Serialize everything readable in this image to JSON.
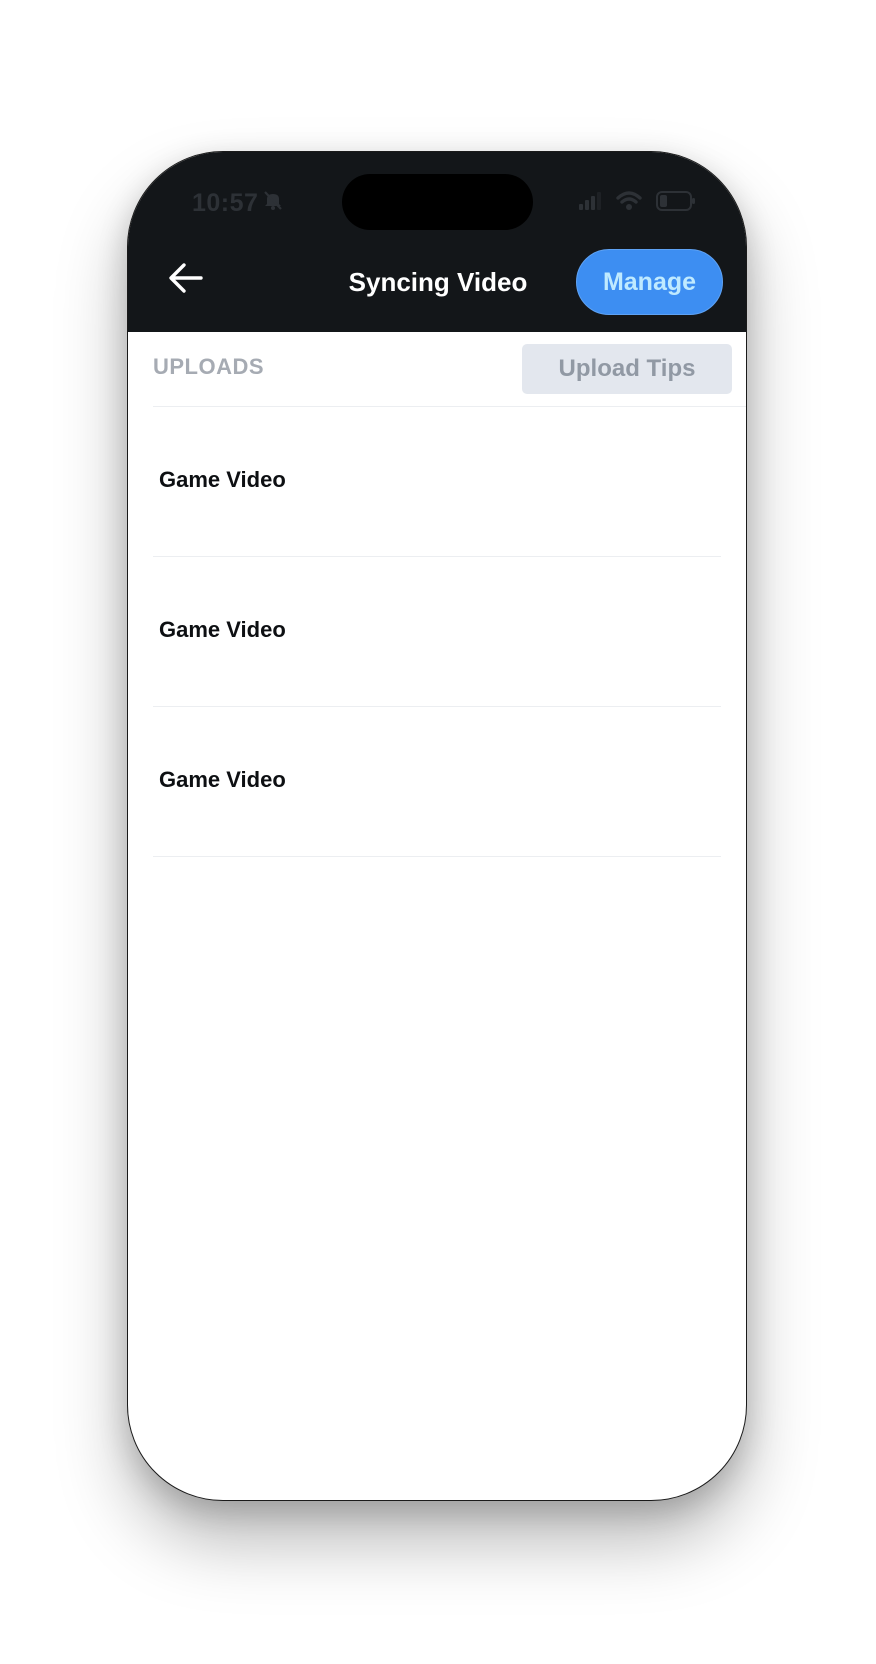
{
  "status_bar": {
    "time": "10:57",
    "icons": [
      "bell-slash-icon",
      "cellular-signal-icon",
      "wifi-icon",
      "battery-icon"
    ]
  },
  "nav": {
    "back_icon": "arrow-left-icon",
    "title": "Syncing Video",
    "manage_label": "Manage"
  },
  "section": {
    "label": "UPLOADS",
    "tips_label": "Upload Tips"
  },
  "uploads": [
    {
      "title": "Game Video"
    },
    {
      "title": "Game Video"
    },
    {
      "title": "Game Video"
    }
  ],
  "colors": {
    "header_bg": "#131619",
    "accent": "#3d8ef2",
    "tips_bg": "#e3e7ee",
    "section_label": "#a6abb3"
  }
}
